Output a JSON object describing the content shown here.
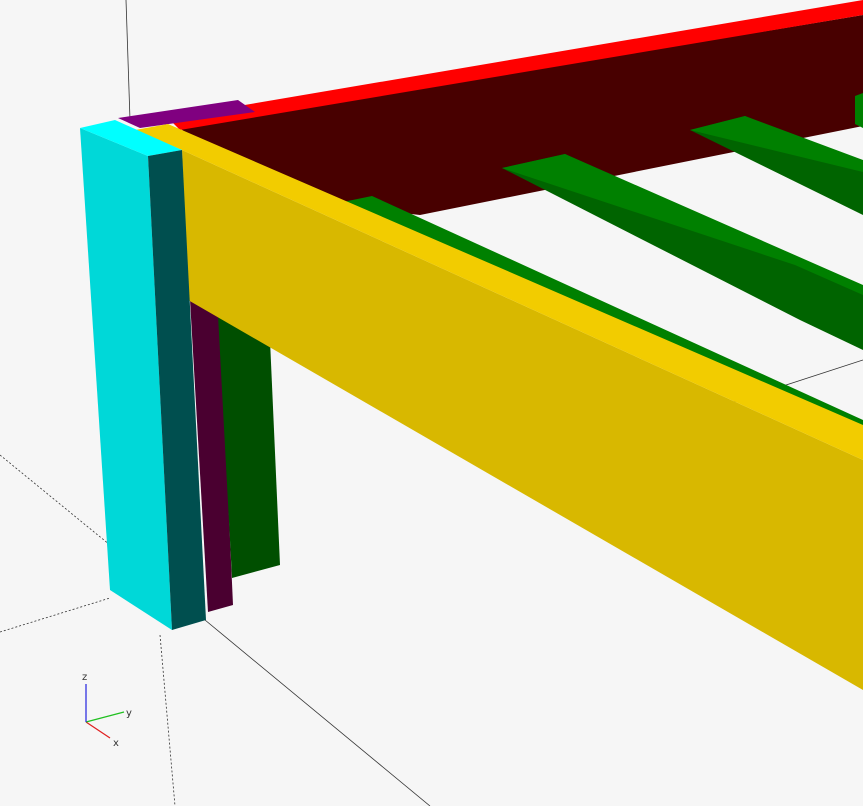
{
  "viewport": {
    "background": "#f6f6f6"
  },
  "axes_indicator": {
    "x_label": "x",
    "y_label": "y",
    "z_label": "z",
    "x_color": "#e02020",
    "y_color": "#20c020",
    "z_color": "#2020e0"
  },
  "parts": [
    {
      "name": "front-leg",
      "colors": [
        "#00d8d8",
        "#00ffff",
        "#004f4f"
      ]
    },
    {
      "name": "front-rail",
      "colors": [
        "#d8b800",
        "#f2cc00"
      ]
    },
    {
      "name": "back-rail",
      "colors": [
        "#480000",
        "#ff0000"
      ]
    },
    {
      "name": "slats",
      "colors": [
        "#008000",
        "#006400"
      ]
    },
    {
      "name": "rear-leg",
      "colors": [
        "#004f00"
      ]
    },
    {
      "name": "cross-piece",
      "colors": [
        "#800080",
        "#4a0030"
      ]
    }
  ]
}
